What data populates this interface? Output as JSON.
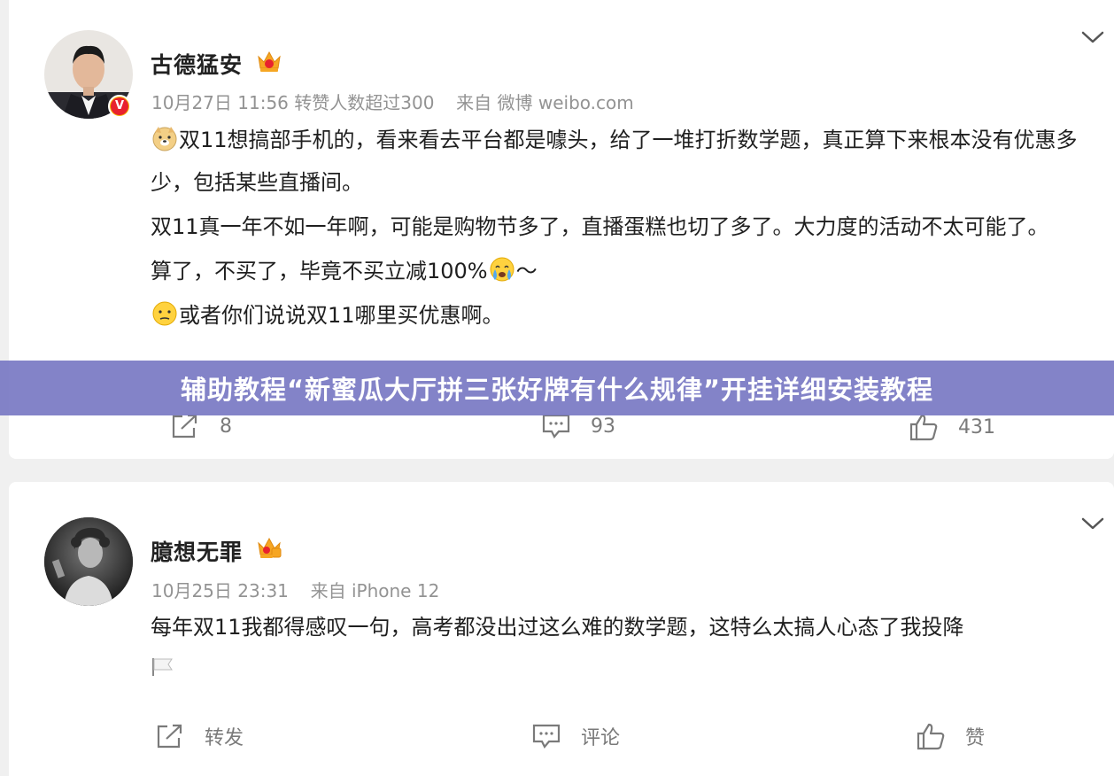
{
  "post1": {
    "author": "古德猛安",
    "meta_date": "10月27日 11:56",
    "meta_repost_note": "转赞人数超过300",
    "meta_source": "来自 微博 weibo.com",
    "verified_badge": "V",
    "paragraphs": [
      {
        "emoji_before": "doge-emoji",
        "text": "双11想搞部手机的，看来看去平台都是噱头，给了一堆打折数学题，真正算下来根本没有优惠多少，包括某些直播间。"
      },
      {
        "text": "双11真一年不如一年啊，可能是购物节多了，直播蛋糕也切了多了。大力度的活动不太可能了。"
      },
      {
        "text": "算了，不买了，毕竟不买立减100%",
        "emoji_after": "crying-emoji",
        "tail": "～"
      },
      {
        "emoji_before": "thinking-emoji",
        "text": "或者你们说说双11哪里买优惠啊。"
      }
    ],
    "actions": {
      "repost_count": "8",
      "comment_count": "93",
      "like_count": "431"
    }
  },
  "post2": {
    "author": "臆想无罪",
    "meta_date": "10月25日 23:31",
    "meta_source": "来自 iPhone 12",
    "paragraphs": [
      {
        "text": "每年双11我都得感叹一句，高考都没出过这么难的数学题，这特么太搞人心态了我投降"
      }
    ],
    "flag_icon": "white-flag-emoji",
    "actions": {
      "repost_label": "转发",
      "comment_label": "评论",
      "like_label": "赞"
    }
  },
  "banner": {
    "text": "辅助教程“新蜜瓜大厅拼三张好牌有什么规律”开挂详细安装教程"
  },
  "colors": {
    "banner_bg": "#7a7ac4",
    "meta_text": "#939393",
    "badge_gold": "#f7b500",
    "badge_red": "#e8222e"
  }
}
